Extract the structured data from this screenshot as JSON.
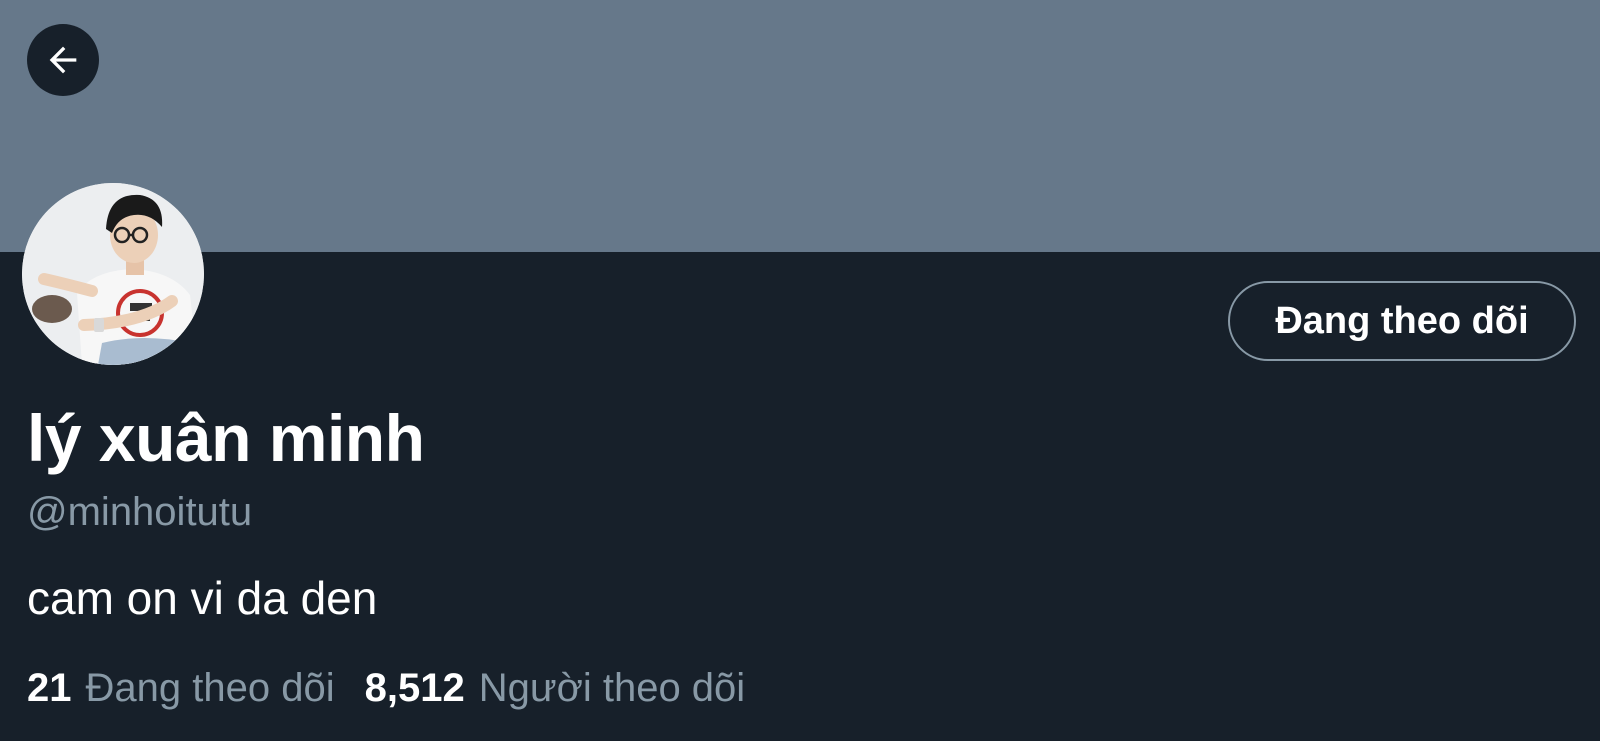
{
  "profile": {
    "display_name": "lý xuân minh",
    "handle": "@minhoitutu",
    "bio": "cam on vi da den",
    "follow_button_label": "Đang theo dõi",
    "following_count": "21",
    "following_label": "Đang theo dõi",
    "followers_count": "8,512",
    "followers_label": "Người theo dõi"
  },
  "icons": {
    "back": "arrow-left-icon"
  },
  "colors": {
    "banner": "#66788a",
    "background": "#17202a",
    "secondary_text": "#8899a6",
    "primary_text": "#ffffff"
  }
}
